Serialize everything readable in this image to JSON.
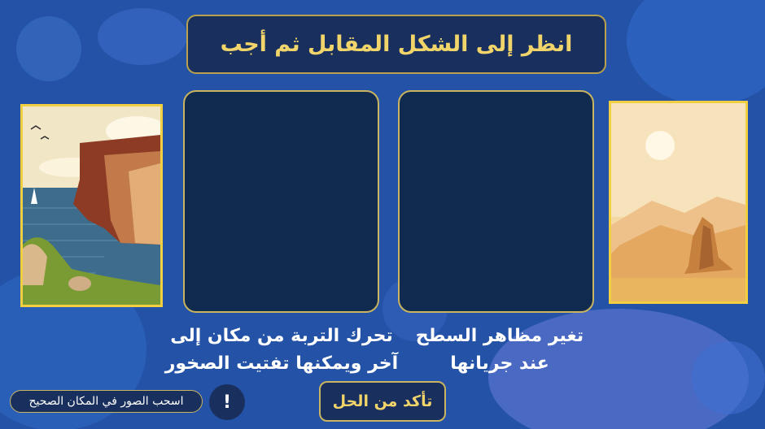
{
  "title": "انظر إلى الشكل المقابل ثم أجب",
  "drop_zones": [
    {
      "caption_line1": "تحرك التربة من مكان إلى",
      "caption_line2": "آخر ويمكنها تفتيت الصخور"
    },
    {
      "caption_line1": "تغير مظاهر السطح",
      "caption_line2": "عند جريانها"
    }
  ],
  "images": [
    {
      "subject": "sea-cliff-illustration"
    },
    {
      "subject": "desert-rock-illustration"
    }
  ],
  "hint_text": "اسحب الصور في المكان الصحيح",
  "info_symbol": "!",
  "check_button_label": "تأكد من الحل",
  "colors": {
    "background": "#2352a6",
    "panel": "#19305e",
    "drop_zone": "#112a50",
    "gold_border": "#c9b460",
    "title_text": "#f1d56a",
    "card_border": "#f2cf40"
  }
}
